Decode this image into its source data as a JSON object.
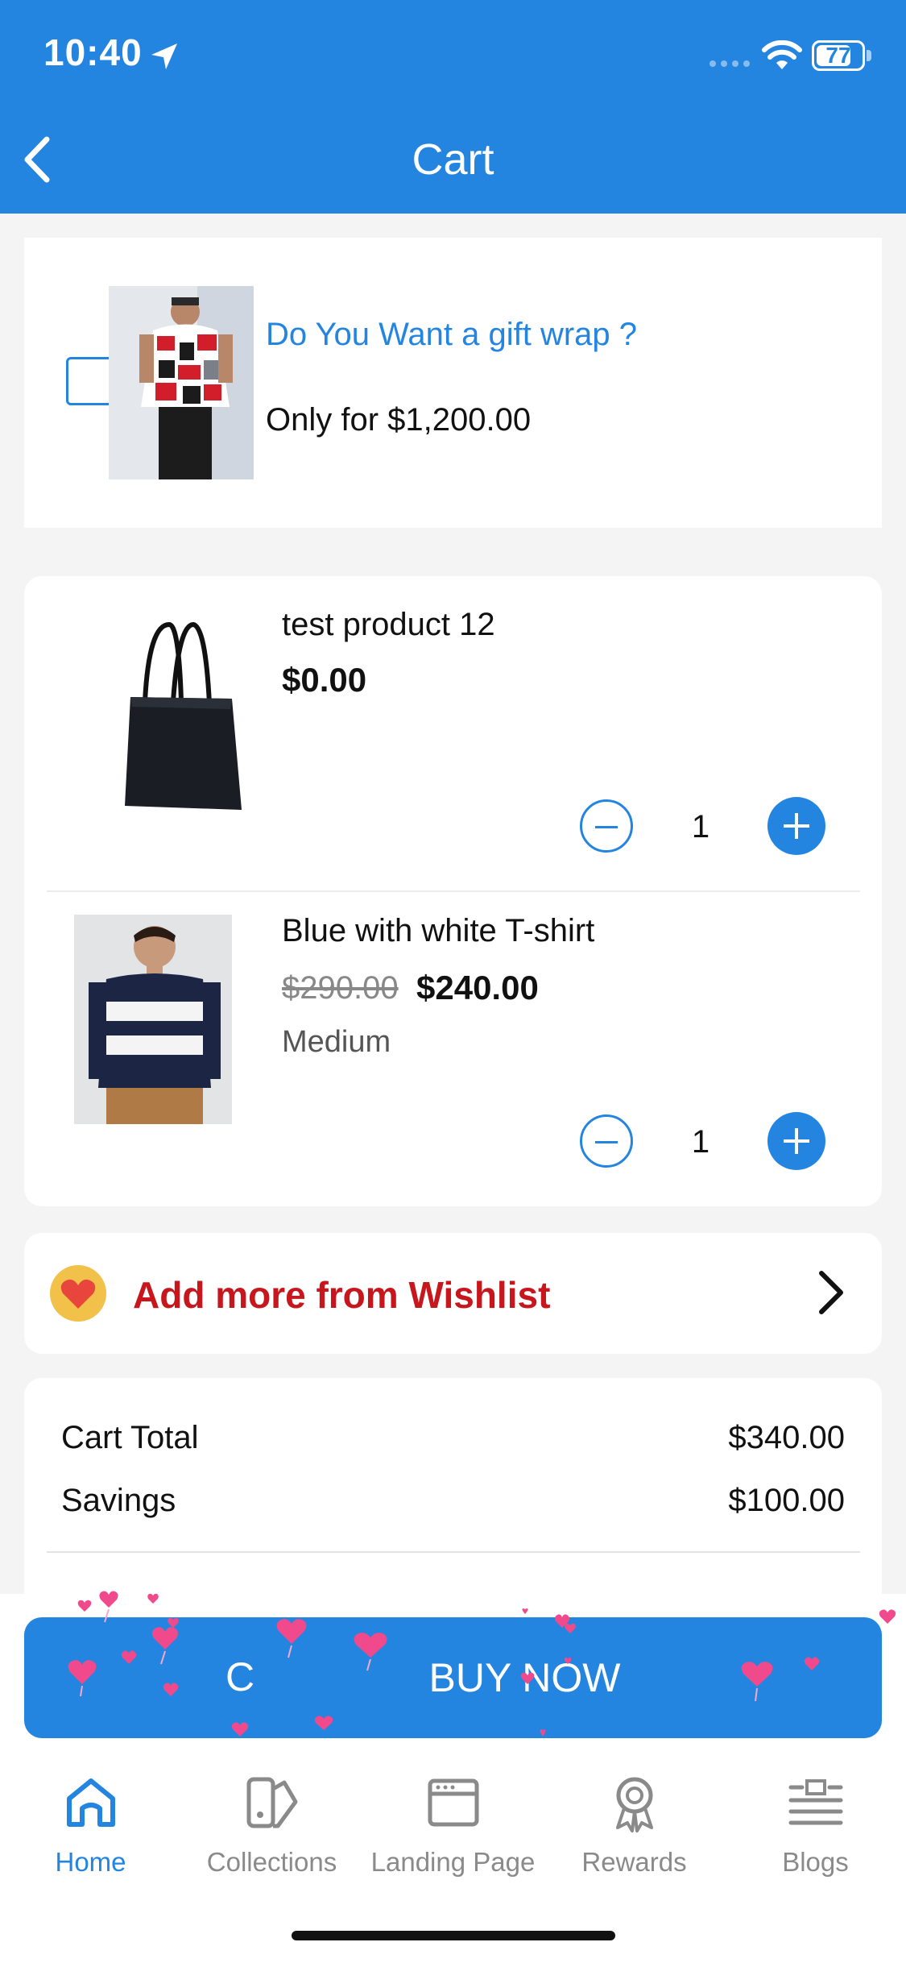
{
  "status_bar": {
    "time": "10:40",
    "battery": "77",
    "battery_level": 0.77,
    "icons": [
      "location-arrow-icon",
      "signal-icon",
      "wifi-icon",
      "battery-icon"
    ]
  },
  "header": {
    "title": "Cart",
    "back_icon": "chevron-left-icon",
    "background": "#2485e0"
  },
  "gift_wrap": {
    "question": "Do You Want a gift wrap ?",
    "price_text": "Only for $1,200.00",
    "checked": false,
    "image": "shirt-photo"
  },
  "cart_items": [
    {
      "name": "test product 12",
      "price": "$0.00",
      "old_price": "",
      "variant": "",
      "quantity": "1",
      "image": "tote-bag-photo"
    },
    {
      "name": "Blue with white T-shirt",
      "price": "$240.00",
      "old_price": "$290.00",
      "variant": "Medium",
      "quantity": "1",
      "image": "striped-tshirt-photo"
    }
  ],
  "wishlist": {
    "label": "Add more from Wishlist",
    "icon": "heart-icon",
    "chevron": "chevron-right-icon"
  },
  "totals": {
    "cart_total_label": "Cart Total",
    "cart_total_value": "$340.00",
    "savings_label": "Savings",
    "savings_value": "$100.00"
  },
  "checkout": {
    "buy_now_label": "BUY NOW",
    "left_fragment": "C"
  },
  "tab_bar": [
    {
      "label": "Home",
      "icon": "home-icon",
      "active": true
    },
    {
      "label": "Collections",
      "icon": "collections-icon",
      "active": false
    },
    {
      "label": "Landing Page",
      "icon": "landing-page-icon",
      "active": false
    },
    {
      "label": "Rewards",
      "icon": "rewards-icon",
      "active": false
    },
    {
      "label": "Blogs",
      "icon": "blogs-icon",
      "active": false
    }
  ],
  "colors": {
    "accent": "#2485e0",
    "wishlist_red": "#c8161d",
    "heart_pink": "#f04a8c"
  }
}
